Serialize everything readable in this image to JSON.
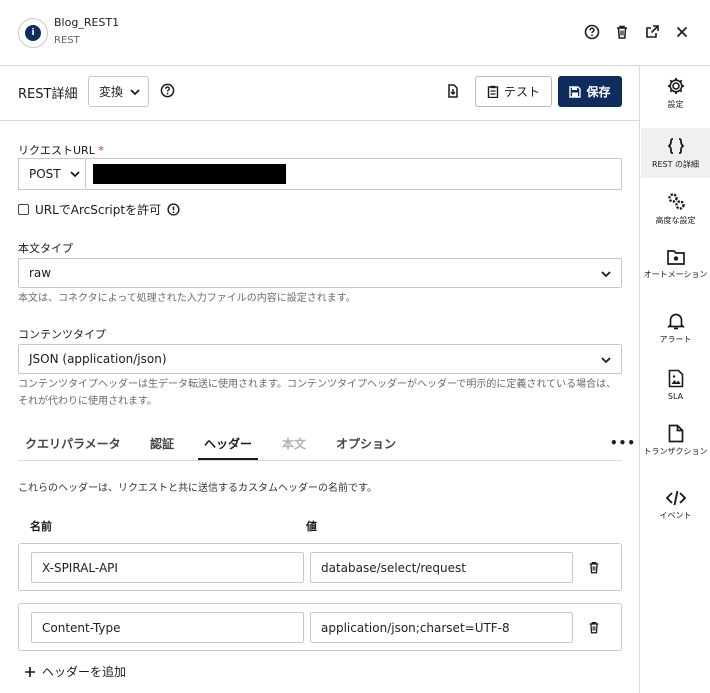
{
  "header": {
    "connector_name": "Blog_REST1",
    "connector_type": "REST",
    "logo_glyph": "i"
  },
  "toolbar": {
    "title": "REST詳細",
    "convert_label": "変換",
    "test_label": "テスト",
    "save_label": "保存"
  },
  "request_url": {
    "label": "リクエストURL",
    "required_mark": "*",
    "method": "POST"
  },
  "arcscript": {
    "label": "URLでArcScriptを許可",
    "checked": false
  },
  "body_type": {
    "label": "本文タイプ",
    "value": "raw",
    "hint": "本文は、コネクタによって処理された入力ファイルの内容に設定されます。"
  },
  "content_type": {
    "label": "コンテンツタイプ",
    "value": "JSON (application/json)",
    "hint": "コンテンツタイプヘッダーは生データ転送に使用されます。コンテンツタイプヘッダーがヘッダーで明示的に定義されている場合は、それが代わりに使用されます。"
  },
  "tabs": [
    {
      "label": "クエリパラメータ",
      "state": "normal"
    },
    {
      "label": "認証",
      "state": "normal"
    },
    {
      "label": "ヘッダー",
      "state": "active"
    },
    {
      "label": "本文",
      "state": "disabled"
    },
    {
      "label": "オプション",
      "state": "normal"
    }
  ],
  "tab_more": "•••",
  "headers_section": {
    "description": "これらのヘッダーは、リクエストと共に送信するカスタムヘッダーの名前です。",
    "col_name": "名前",
    "col_value": "値",
    "rows": [
      {
        "name": "X-SPIRAL-API",
        "value": "database/select/request"
      },
      {
        "name": "Content-Type",
        "value": "application/json;charset=UTF-8"
      }
    ],
    "add_label": "ヘッダーを追加"
  },
  "rail": [
    {
      "label": "設定",
      "icon": "gear-icon",
      "active": false
    },
    {
      "label": "REST の詳細",
      "icon": "braces-icon",
      "active": true
    },
    {
      "label": "高度な設定",
      "icon": "gears-icon",
      "active": false
    },
    {
      "label": "オートメーション",
      "icon": "folder-gear-icon",
      "active": false
    },
    {
      "label": "アラート",
      "icon": "bell-icon",
      "active": false
    },
    {
      "label": "SLA",
      "icon": "image-file-icon",
      "active": false
    },
    {
      "label": "トランザクション",
      "icon": "file-icon",
      "active": false
    },
    {
      "label": "イベント",
      "icon": "code-icon",
      "active": false
    }
  ],
  "colors": {
    "primary": "#0e2d5e",
    "required": "#c0392b"
  }
}
